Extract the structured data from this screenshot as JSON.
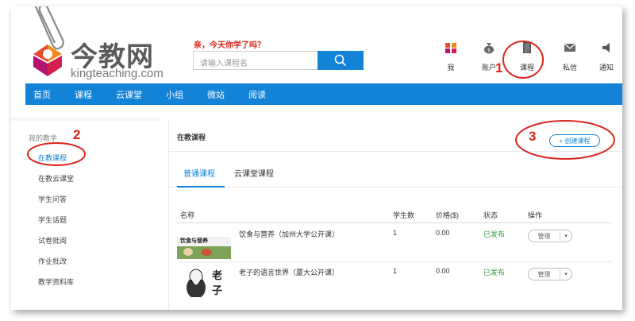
{
  "header": {
    "logo_cn": "今教网",
    "logo_en": "kingteaching.com",
    "slogan": "亲，今天你学了吗？",
    "search_placeholder": "请输入课程名"
  },
  "top_icons": [
    {
      "label": "我",
      "icon": "user-grid-icon"
    },
    {
      "label": "账户",
      "icon": "money-bag-icon"
    },
    {
      "label": "课程",
      "icon": "book-icon"
    },
    {
      "label": "私信",
      "icon": "envelope-icon"
    },
    {
      "label": "通知",
      "icon": "speaker-icon"
    }
  ],
  "nav": [
    "首页",
    "课程",
    "云课堂",
    "小组",
    "微站",
    "阅读"
  ],
  "sidebar": {
    "title": "我的教学",
    "items": [
      "在教课程",
      "在教云课堂",
      "学生问答",
      "学生话题",
      "试卷批阅",
      "作业批改",
      "教学资料库"
    ],
    "active": "在教课程"
  },
  "content": {
    "title": "在教课程",
    "create_label": "+ 创建课程",
    "tabs": [
      "普通课程",
      "云课堂课程"
    ],
    "active_tab": "普通课程",
    "columns": [
      "名称",
      "学生数",
      "价格($)",
      "状态",
      "操作"
    ],
    "rows": [
      {
        "name": "饮食与营养（加州大学公开课）",
        "students": "1",
        "price": "0.00",
        "status": "已发布",
        "action": "管理",
        "thumb_text": "饮食与营养"
      },
      {
        "name": "老子的语言世界（厦大公开课）",
        "students": "1",
        "price": "0.00",
        "status": "已发布",
        "action": "管理",
        "thumb_text": "老子"
      }
    ]
  },
  "annotations": [
    "1",
    "2",
    "3"
  ],
  "colors": {
    "brand_blue": "#1383d8",
    "accent_red": "#d9261c",
    "published_green": "#2e9d3a"
  }
}
